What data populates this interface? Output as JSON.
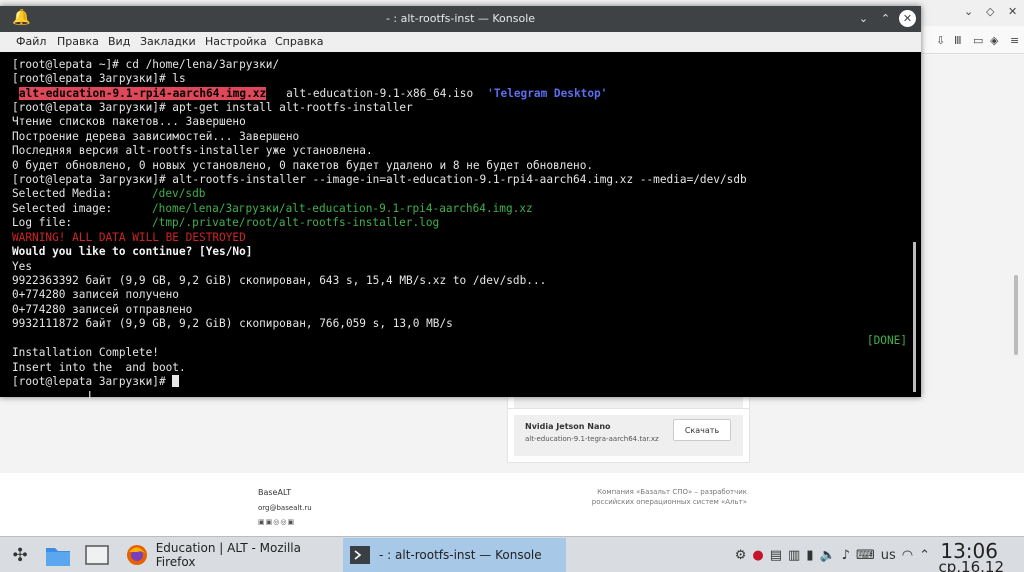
{
  "browser": {
    "downloads": [
      {
        "title": "",
        "file": "",
        "button": ""
      },
      {
        "title": "Nvidia Jetson Nano",
        "file": "alt-education-9.1-tegra-aarch64.tar.xz",
        "button": "Скачать"
      }
    ],
    "footer": {
      "brand": "BaseALT",
      "email": "org@basealt.ru",
      "note": "Компания «Базальт СПО» – разработчик российских операционных систем «Альт»"
    }
  },
  "konsole": {
    "title": "- : alt-rootfs-inst — Konsole",
    "menu": [
      "Файл",
      "Правка",
      "Вид",
      "Закладки",
      "Настройка",
      "Справка"
    ],
    "lines": {
      "l1": "[root@lepata ~]# cd /home/lena/Загрузки/",
      "l2": "[root@lepata Загрузки]# ls",
      "l3a": "alt-education-9.1-rpi4-aarch64.img.xz",
      "l3b": "alt-education-9.1-x86_64.iso",
      "l3c": "'Telegram Desktop'",
      "l4": "[root@lepata Загрузки]# apt-get install alt-rootfs-installer",
      "l5": "Чтение списков пакетов... Завершено",
      "l6": "Построение дерева зависимостей... Завершено",
      "l7": "Последняя версия alt-rootfs-installer уже установлена.",
      "l8": "0 будет обновлено, 0 новых установлено, 0 пакетов будет удалено и 8 не будет обновлено.",
      "l9": "[root@lepata Загрузки]# alt-rootfs-installer --image-in=alt-education-9.1-rpi4-aarch64.img.xz --media=/dev/sdb",
      "l10a": "Selected Media:",
      "l10b": "/dev/sdb",
      "l11a": "Selected image:",
      "l11b": "/home/lena/Загрузки/alt-education-9.1-rpi4-aarch64.img.xz",
      "l12a": "Log file:",
      "l12b": "/tmp/.private/root/alt-rootfs-installer.log",
      "l13": "WARNING! ALL DATA WILL BE DESTROYED",
      "l14": "Would you like to continue? [Yes/No]",
      "l15": "Yes",
      "l16": "9922363392 байт (9,9 GB, 9,2 GiB) скопирован, 643 s, 15,4 MB/s.xz to /dev/sdb...",
      "l17": "0+774280 записей получено",
      "l18": "0+774280 записей отправлено",
      "l19": "9932111872 байт (9,9 GB, 9,2 GiB) скопирован, 766,059 s, 13,0 MB/s",
      "done": "[DONE]",
      "l21": "Installation Complete!",
      "l22": "Insert into the  and boot.",
      "l23": "[root@lepata Загрузки]# "
    }
  },
  "taskbar": {
    "tasks": [
      "Education | ALT - Mozilla Firefox",
      "- : alt-rootfs-inst — Konsole"
    ],
    "keyboard_layout": "us",
    "time": "13:06",
    "date": "ср,16.12"
  },
  "colors": {
    "terminal_bg": "#000000",
    "titlebar": "#3e4244",
    "active_task": "#a8c8e8",
    "highlight_red": "#e0485a",
    "dir_blue": "#5c6ef0",
    "path_green": "#3fb04a",
    "warning_red": "#d02424"
  }
}
